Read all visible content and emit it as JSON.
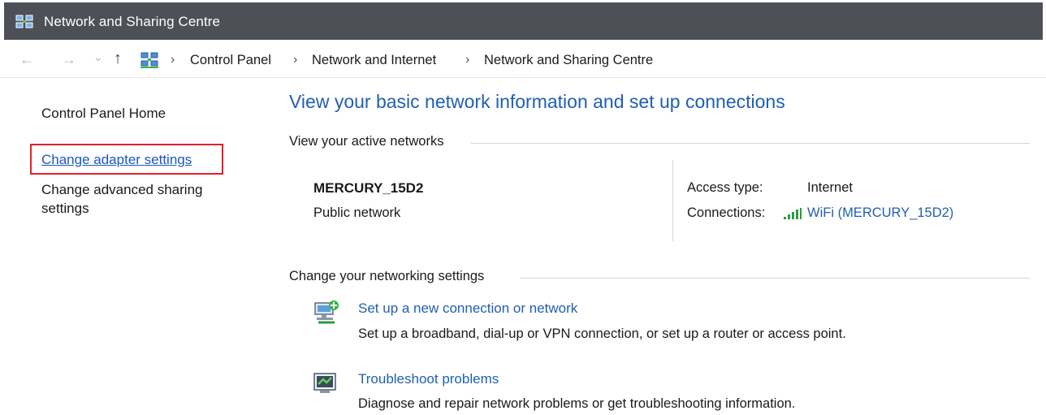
{
  "window": {
    "title": "Network and Sharing Centre"
  },
  "address_bar": {
    "nav": {
      "back": "←",
      "forward": "→",
      "recent": "⌄",
      "up": "↑"
    },
    "crumbs": [
      "Control Panel",
      "Network and Internet",
      "Network and Sharing Centre"
    ],
    "separator": "›"
  },
  "sidebar": {
    "home": "Control Panel Home",
    "items": [
      "Change adapter settings",
      "Change advanced sharing",
      "settings"
    ]
  },
  "main": {
    "title": "View your basic network information and set up connections",
    "active_networks_label": "View your active networks",
    "network": {
      "name": "MERCURY_15D2",
      "type": "Public network",
      "access_type_label": "Access type:",
      "access_type_value": "Internet",
      "connections_label": "Connections:",
      "connections_value": "WiFi (MERCURY_15D2)"
    },
    "change_settings_label": "Change your networking settings",
    "tasks": [
      {
        "title": "Set up a new connection or network",
        "desc": "Set up a broadband, dial-up or VPN connection, or set up a router or access point.",
        "icon": "network-setup-icon"
      },
      {
        "title": "Troubleshoot problems",
        "desc": "Diagnose and repair network problems or get troubleshooting information.",
        "icon": "troubleshoot-icon"
      }
    ]
  },
  "colors": {
    "title_bar": "#4d5157",
    "link": "#1f5fb5",
    "highlight_box": "#e5202a"
  }
}
